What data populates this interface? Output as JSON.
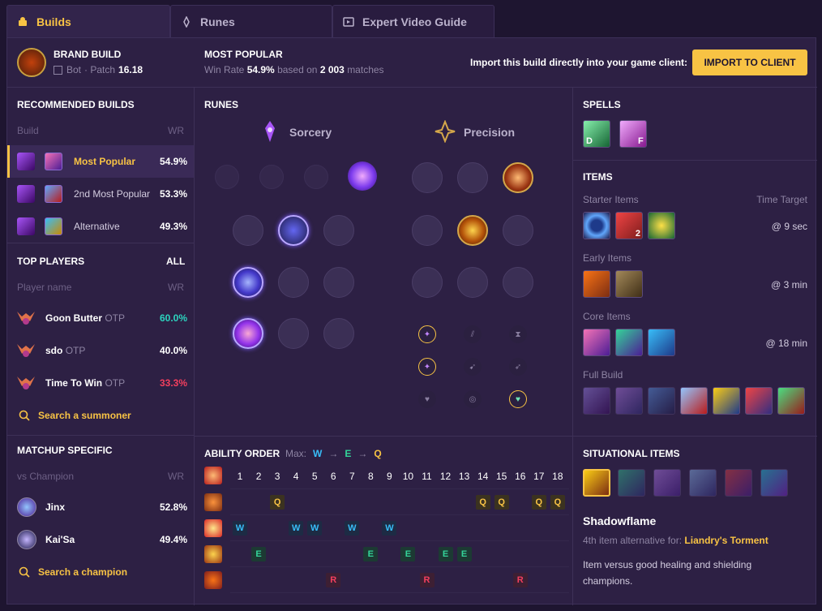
{
  "tabs": [
    {
      "label": "Builds"
    },
    {
      "label": "Runes"
    },
    {
      "label": "Expert Video Guide"
    }
  ],
  "header": {
    "title": "BRAND BUILD",
    "role": "Bot",
    "patch_prefix": "· Patch",
    "patch": "16.18",
    "mp_title": "MOST POPULAR",
    "wr_label": "Win Rate",
    "wr": "54.9%",
    "based_on": "based on",
    "matches": "2 003",
    "matches_label": "matches",
    "import_text": "Import this build directly into your game client:",
    "import_btn": "IMPORT TO CLIENT"
  },
  "recommended": {
    "title": "RECOMMENDED BUILDS",
    "col_build": "Build",
    "col_wr": "WR",
    "rows": [
      {
        "label": "Most Popular",
        "wr": "54.9%"
      },
      {
        "label": "2nd Most Popular",
        "wr": "53.3%"
      },
      {
        "label": "Alternative",
        "wr": "49.3%"
      }
    ]
  },
  "top_players": {
    "title": "TOP PLAYERS",
    "all": "ALL",
    "col_name": "Player name",
    "col_wr": "WR",
    "rows": [
      {
        "name": "Goon Butter",
        "tag": "OTP",
        "wr": "60.0%",
        "color": "#2dd4bf"
      },
      {
        "name": "sdo",
        "tag": "OTP",
        "wr": "40.0%",
        "color": "#ffffff"
      },
      {
        "name": "Time To Win",
        "tag": "OTP",
        "wr": "33.3%",
        "color": "#f43f5e"
      }
    ],
    "search": "Search a summoner"
  },
  "matchup": {
    "title": "MATCHUP SPECIFIC",
    "col_name": "vs Champion",
    "col_wr": "WR",
    "rows": [
      {
        "name": "Jinx",
        "wr": "52.8%"
      },
      {
        "name": "Kai'Sa",
        "wr": "49.4%"
      }
    ],
    "search": "Search a champion"
  },
  "runes": {
    "title": "RUNES",
    "primary": "Sorcery",
    "secondary": "Precision"
  },
  "spells": {
    "title": "SPELLS",
    "d": "D",
    "f": "F"
  },
  "items": {
    "title": "ITEMS",
    "starter": "Starter Items",
    "time_target": "Time Target",
    "starter_time": "@ 9 sec",
    "starter_count": "2",
    "early": "Early Items",
    "early_time": "@ 3 min",
    "core": "Core Items",
    "core_time": "@ 18 min",
    "full": "Full Build"
  },
  "ability": {
    "title": "ABILITY ORDER",
    "max_label": "Max:",
    "max": [
      "W",
      "E",
      "Q"
    ],
    "arrow": "→",
    "levels": [
      "1",
      "2",
      "3",
      "4",
      "5",
      "6",
      "7",
      "8",
      "9",
      "10",
      "11",
      "12",
      "13",
      "14",
      "15",
      "16",
      "17",
      "18"
    ]
  },
  "situational": {
    "title": "SITUATIONAL ITEMS",
    "name": "Shadowflame",
    "alt_prefix": "4th item alternative for:",
    "alt_item": "Liandry's Torment",
    "desc": "Item versus good healing and shielding champions."
  }
}
